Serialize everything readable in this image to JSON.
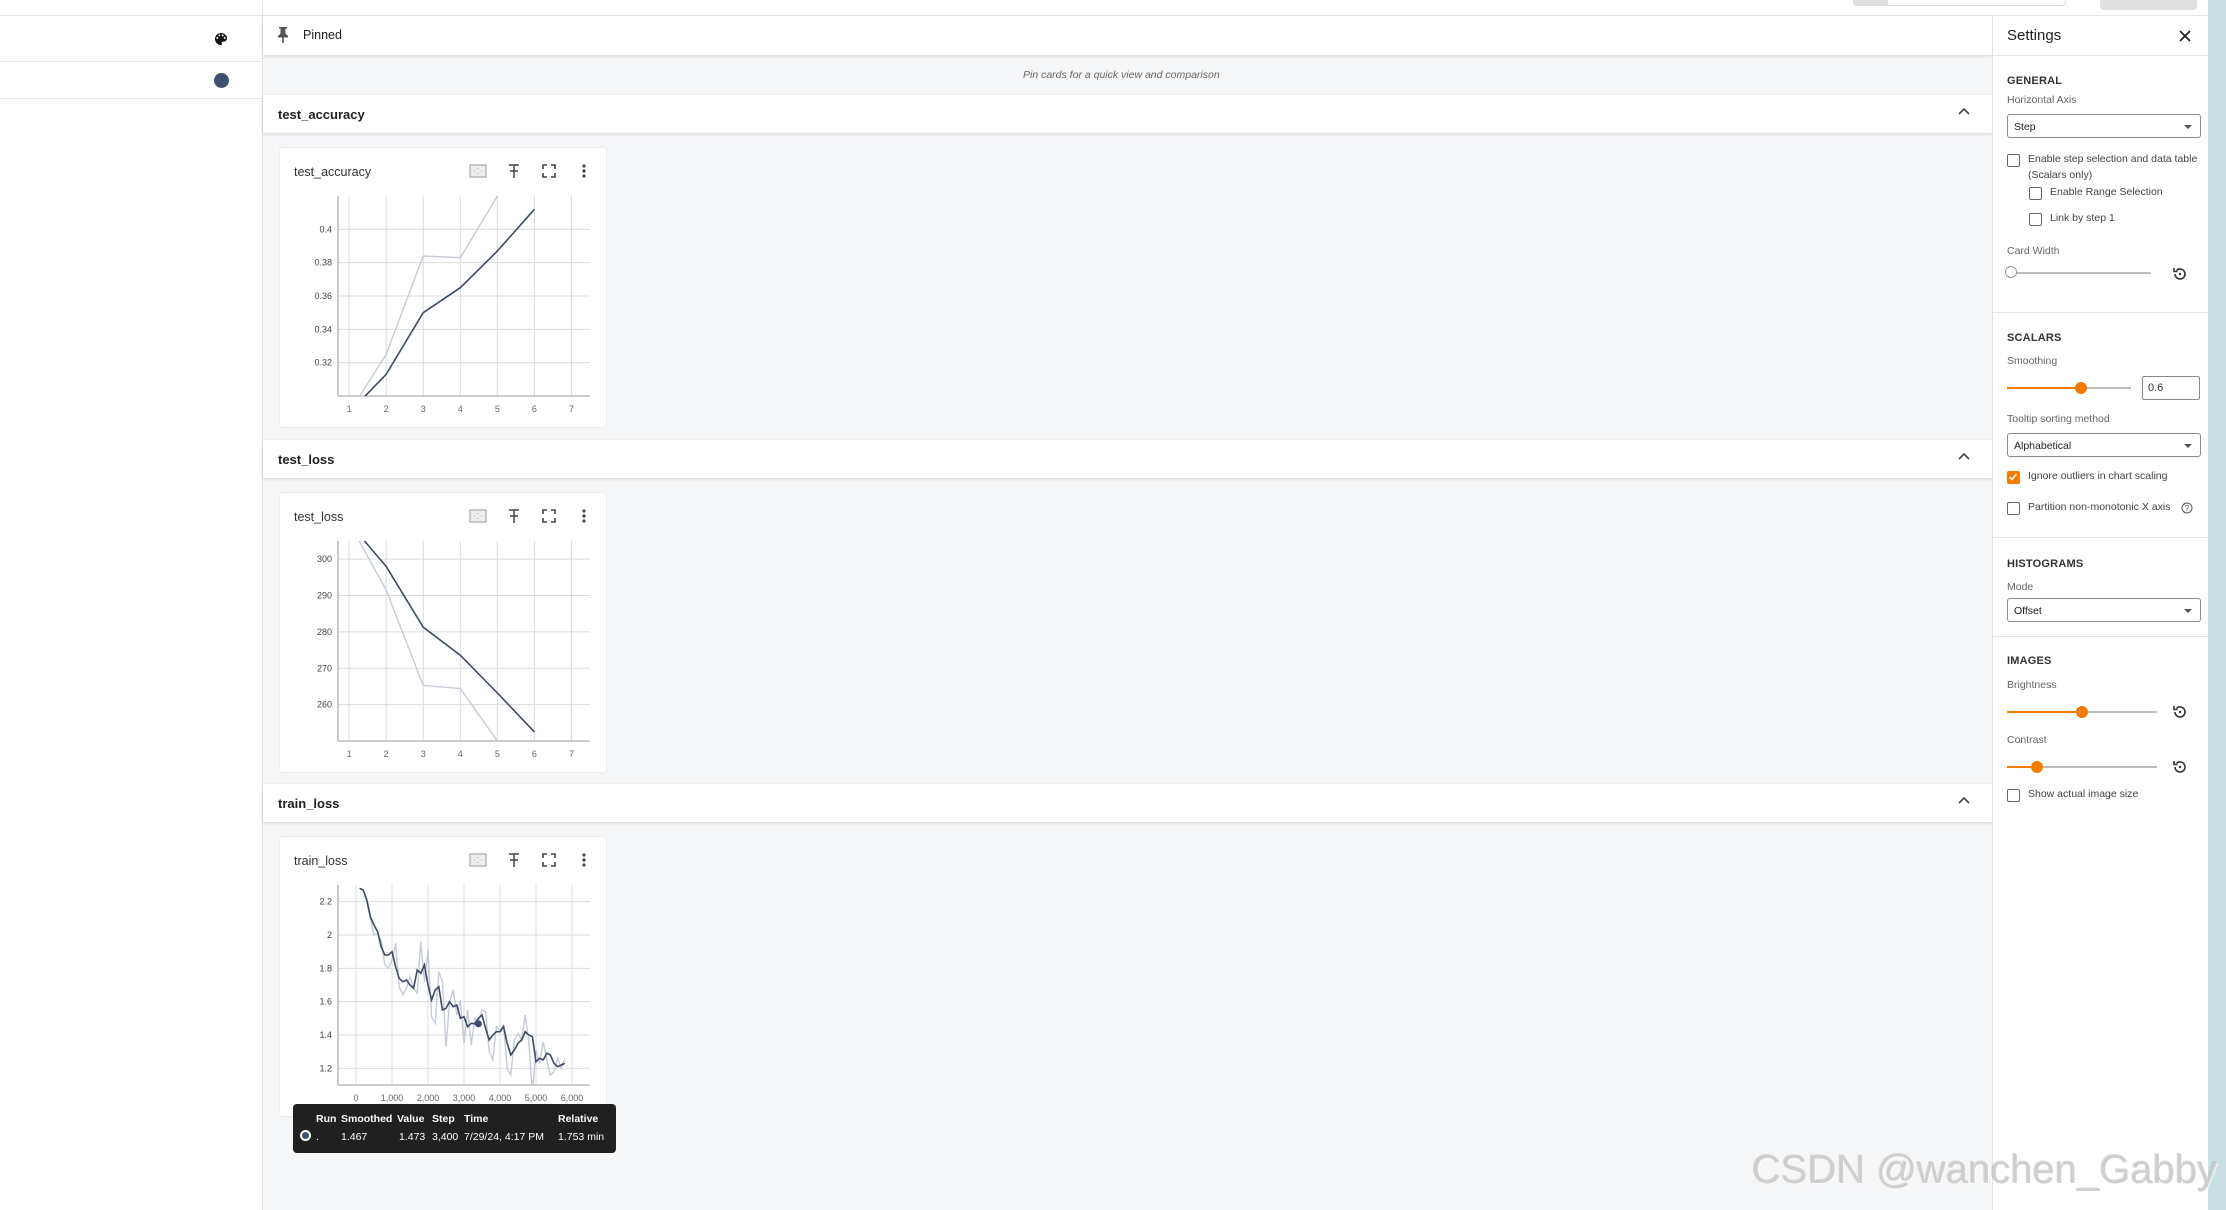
{
  "sidebar": {
    "palette_icon": "palette-icon",
    "run_color": "#3f5170"
  },
  "pinned": {
    "label": "Pinned",
    "hint": "Pin cards for a quick view and comparison"
  },
  "sections": [
    {
      "title": "test_accuracy",
      "card_title": "test_accuracy"
    },
    {
      "title": "test_loss",
      "card_title": "test_loss"
    },
    {
      "title": "train_loss",
      "card_title": "train_loss"
    }
  ],
  "card_tools": [
    "fit-domain-icon",
    "pin-icon",
    "fullscreen-icon",
    "more-vert-icon"
  ],
  "tooltip": {
    "headers": [
      "Run",
      "Smoothed",
      "Value",
      "Step",
      "Time",
      "Relative"
    ],
    "row": {
      "run": ".",
      "smoothed": "1.467",
      "value": "1.473",
      "step": "3,400",
      "time": "7/29/24, 4:17 PM",
      "relative": "1.753 min"
    }
  },
  "settings": {
    "title": "Settings",
    "general": {
      "heading": "GENERAL",
      "horizontal_axis_label": "Horizontal Axis",
      "horizontal_axis_value": "Step",
      "step_selection_label": "Enable step selection and data table",
      "step_selection_sub": "(Scalars only)",
      "step_selection_checked": false,
      "range_selection_label": "Enable Range Selection",
      "range_selection_checked": false,
      "link_by_step_label": "Link by step 1",
      "link_by_step_checked": false,
      "card_width_label": "Card Width",
      "card_width_value": 0
    },
    "scalars": {
      "heading": "SCALARS",
      "smoothing_label": "Smoothing",
      "smoothing_value": "0.6",
      "tooltip_sort_label": "Tooltip sorting method",
      "tooltip_sort_value": "Alphabetical",
      "ignore_outliers_label": "Ignore outliers in chart scaling",
      "ignore_outliers_checked": true,
      "partition_label": "Partition non-monotonic X axis",
      "partition_checked": false
    },
    "histograms": {
      "heading": "HISTOGRAMS",
      "mode_label": "Mode",
      "mode_value": "Offset"
    },
    "images": {
      "heading": "IMAGES",
      "brightness_label": "Brightness",
      "brightness_fraction": 0.5,
      "contrast_label": "Contrast",
      "contrast_fraction": 0.2,
      "actual_size_label": "Show actual image size",
      "actual_size_checked": false
    }
  },
  "watermark": "CSDN @wanchen_Gabby",
  "colors": {
    "accent": "#f57c00",
    "smoothed_line": "#3b4a66",
    "raw_line": "#c5cbd8"
  },
  "chart_data": [
    {
      "type": "line",
      "title": "test_accuracy",
      "xlabel": "",
      "ylabel": "",
      "x_ticks": [
        1,
        2,
        3,
        4,
        5,
        6,
        7
      ],
      "y_ticks": [
        0.32,
        0.34,
        0.36,
        0.38,
        0.4
      ],
      "xlim": [
        0.7,
        7.5
      ],
      "ylim": [
        0.3,
        0.42
      ],
      "grid": true,
      "series": [
        {
          "name": "raw",
          "x": [
            1,
            2,
            3,
            4,
            5,
            6
          ],
          "y": [
            0.29,
            0.325,
            0.384,
            0.383,
            0.42,
            0.45
          ]
        },
        {
          "name": "smoothed",
          "x": [
            1,
            2,
            3,
            4,
            5,
            6
          ],
          "y": [
            0.29,
            0.313,
            0.35,
            0.365,
            0.387,
            0.412
          ]
        }
      ]
    },
    {
      "type": "line",
      "title": "test_loss",
      "xlabel": "",
      "ylabel": "",
      "x_ticks": [
        1,
        2,
        3,
        4,
        5,
        6,
        7
      ],
      "y_ticks": [
        260,
        270,
        280,
        290,
        300
      ],
      "xlim": [
        0.7,
        7.5
      ],
      "ylim": [
        250,
        305
      ],
      "grid": true,
      "series": [
        {
          "name": "raw",
          "x": [
            1,
            2,
            3,
            4,
            5,
            6
          ],
          "y": [
            310,
            291.5,
            265.3,
            264.4,
            250,
            238
          ]
        },
        {
          "name": "smoothed",
          "x": [
            1,
            2,
            3,
            4,
            5,
            6
          ],
          "y": [
            310,
            298,
            281.3,
            273.6,
            263.2,
            252.5
          ]
        }
      ]
    },
    {
      "type": "line",
      "title": "train_loss",
      "xlabel": "",
      "ylabel": "",
      "x_ticks": [
        0,
        1000,
        2000,
        3000,
        4000,
        5000,
        6000
      ],
      "x_tick_labels": [
        "0",
        "1,000",
        "2,000",
        "3,000",
        "4,000",
        "5,000",
        "6,000"
      ],
      "y_ticks": [
        1.2,
        1.4,
        1.6,
        1.8,
        2.0,
        2.2
      ],
      "y_tick_labels": [
        "1.2",
        "1.4",
        "1.6",
        "1.8",
        "2",
        "2.2"
      ],
      "xlim": [
        -500,
        6500
      ],
      "ylim": [
        1.1,
        2.3
      ],
      "grid": true,
      "highlight_point": {
        "x": 3400,
        "y": 1.467
      },
      "series": [
        {
          "name": "raw",
          "x": [
            100,
            200,
            300,
            400,
            500,
            600,
            700,
            800,
            900,
            1000,
            1100,
            1200,
            1300,
            1400,
            1500,
            1600,
            1700,
            1800,
            1900,
            2000,
            2100,
            2200,
            2300,
            2400,
            2500,
            2600,
            2700,
            2800,
            2900,
            3000,
            3100,
            3200,
            3300,
            3400,
            3500,
            3600,
            3700,
            3800,
            3900,
            4000,
            4100,
            4200,
            4300,
            4400,
            4500,
            4600,
            4700,
            4800,
            4900,
            5000,
            5100,
            5200,
            5300,
            5400,
            5500,
            5600,
            5700,
            5800
          ],
          "y": [
            2.28,
            2.27,
            2.2,
            2.1,
            2.0,
            2.01,
            1.97,
            1.82,
            1.8,
            1.85,
            1.95,
            1.69,
            1.64,
            1.68,
            1.75,
            1.68,
            1.65,
            1.96,
            1.72,
            1.91,
            1.51,
            1.47,
            1.78,
            1.72,
            1.33,
            1.6,
            1.67,
            1.52,
            1.61,
            1.35,
            1.55,
            1.34,
            1.5,
            1.48,
            1.55,
            1.54,
            1.3,
            1.25,
            1.45,
            1.43,
            1.46,
            1.2,
            1.16,
            1.37,
            1.41,
            1.37,
            1.52,
            1.36,
            1.05,
            1.31,
            1.23,
            1.36,
            1.25,
            1.16,
            1.18,
            1.26,
            1.2,
            1.26
          ]
        },
        {
          "name": "smoothed",
          "x": [
            100,
            200,
            300,
            400,
            500,
            600,
            700,
            800,
            900,
            1000,
            1100,
            1200,
            1300,
            1400,
            1500,
            1600,
            1700,
            1800,
            1900,
            2000,
            2100,
            2200,
            2300,
            2400,
            2500,
            2600,
            2700,
            2800,
            2900,
            3000,
            3100,
            3200,
            3300,
            3400,
            3500,
            3600,
            3700,
            3800,
            3900,
            4000,
            4100,
            4200,
            4300,
            4400,
            4500,
            4600,
            4700,
            4800,
            4900,
            5000,
            5100,
            5200,
            5300,
            5400,
            5500,
            5600,
            5700,
            5800
          ],
          "y": [
            2.28,
            2.27,
            2.21,
            2.11,
            2.06,
            2.02,
            1.93,
            1.88,
            1.88,
            1.9,
            1.81,
            1.74,
            1.72,
            1.73,
            1.7,
            1.68,
            1.79,
            1.77,
            1.82,
            1.7,
            1.61,
            1.67,
            1.69,
            1.55,
            1.56,
            1.6,
            1.57,
            1.58,
            1.5,
            1.51,
            1.45,
            1.47,
            1.467,
            1.5,
            1.52,
            1.44,
            1.37,
            1.4,
            1.42,
            1.42,
            1.45,
            1.35,
            1.28,
            1.31,
            1.35,
            1.37,
            1.42,
            1.4,
            1.39,
            1.24,
            1.26,
            1.25,
            1.29,
            1.28,
            1.23,
            1.21,
            1.22,
            1.23
          ]
        }
      ]
    }
  ]
}
